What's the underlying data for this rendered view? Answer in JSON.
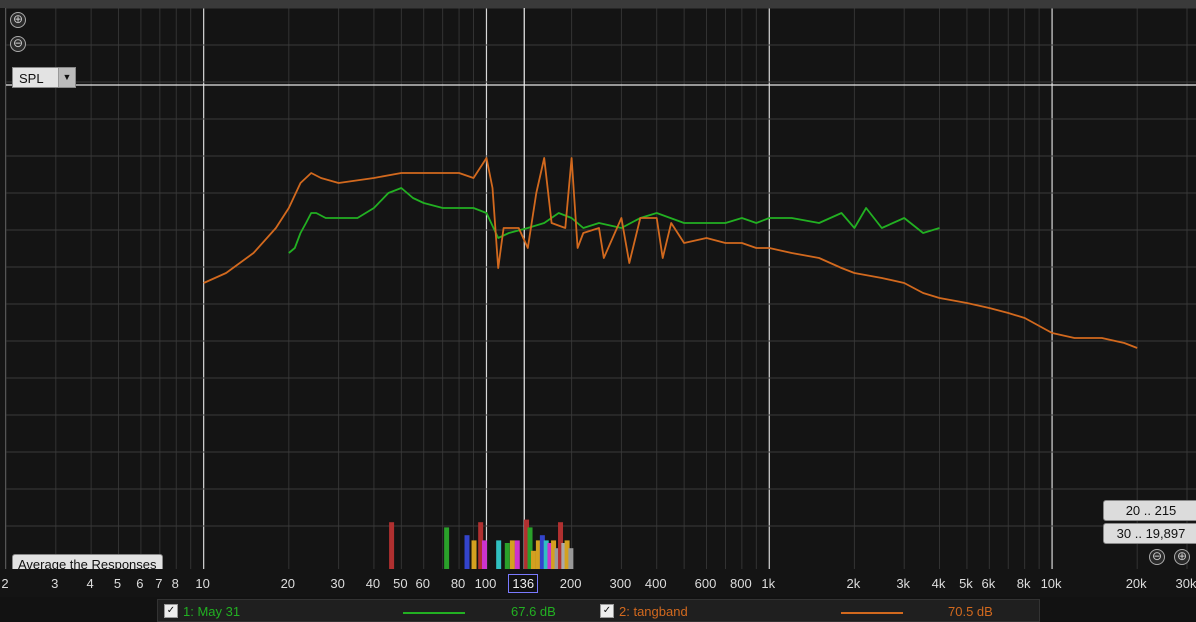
{
  "topbar": {},
  "controls": {
    "zoom_in": "⊕",
    "zoom_out": "⊖",
    "display_mode": "SPL",
    "average_button": "Average the Responses",
    "range_low": "20 .. 215",
    "range_high": "30 .. 19,897",
    "bottom_zoom_out": "⊖",
    "bottom_zoom_in": "⊕"
  },
  "axis": {
    "ticks": [
      "2",
      "3",
      "4",
      "5",
      "6",
      "7",
      "8",
      "10",
      "20",
      "30",
      "40",
      "50",
      "60",
      "80",
      "100",
      "136",
      "200",
      "300",
      "400",
      "600",
      "800",
      "1k",
      "2k",
      "3k",
      "4k",
      "5k",
      "6k",
      "8k",
      "10k",
      "20k",
      "30k"
    ],
    "tick_freqs": [
      2,
      3,
      4,
      5,
      6,
      7,
      8,
      10,
      20,
      30,
      40,
      50,
      60,
      80,
      100,
      136,
      200,
      300,
      400,
      600,
      800,
      1000,
      2000,
      3000,
      4000,
      5000,
      6000,
      8000,
      10000,
      20000,
      30000
    ],
    "cursor_label": "136",
    "cursor_freq": 136,
    "f_min": 2,
    "f_max": 30000
  },
  "legend": {
    "items": [
      {
        "checked": "✓",
        "label": "1: May 31",
        "value": "67.6 dB",
        "color": "#22b022"
      },
      {
        "checked": "✓",
        "label": "2: tangband",
        "value": "70.5 dB",
        "color": "#d2691e"
      }
    ]
  },
  "chart_data": {
    "type": "line",
    "x_scale": "log",
    "xlim": [
      2,
      30000
    ],
    "ylim": [
      0,
      100
    ],
    "series": [
      {
        "name": "1: May 31",
        "color": "#22b022",
        "points": [
          [
            20,
            51
          ],
          [
            21,
            52
          ],
          [
            22,
            55
          ],
          [
            23,
            57
          ],
          [
            24,
            59
          ],
          [
            25,
            59
          ],
          [
            27,
            58
          ],
          [
            30,
            58
          ],
          [
            35,
            58
          ],
          [
            40,
            60
          ],
          [
            45,
            63
          ],
          [
            50,
            64
          ],
          [
            55,
            62
          ],
          [
            60,
            61
          ],
          [
            70,
            60
          ],
          [
            80,
            60
          ],
          [
            90,
            60
          ],
          [
            100,
            59
          ],
          [
            110,
            54
          ],
          [
            120,
            55
          ],
          [
            140,
            56
          ],
          [
            160,
            57
          ],
          [
            180,
            59
          ],
          [
            200,
            58
          ],
          [
            220,
            56
          ],
          [
            250,
            57
          ],
          [
            300,
            56
          ],
          [
            350,
            58
          ],
          [
            400,
            59
          ],
          [
            500,
            57
          ],
          [
            600,
            57
          ],
          [
            700,
            57
          ],
          [
            800,
            58
          ],
          [
            900,
            57
          ],
          [
            1000,
            58
          ],
          [
            1200,
            58
          ],
          [
            1500,
            57
          ],
          [
            1800,
            59
          ],
          [
            2000,
            56
          ],
          [
            2200,
            60
          ],
          [
            2500,
            56
          ],
          [
            3000,
            58
          ],
          [
            3500,
            55
          ],
          [
            4000,
            56
          ]
        ]
      },
      {
        "name": "2: tangband",
        "color": "#d2691e",
        "points": [
          [
            10,
            45
          ],
          [
            12,
            47
          ],
          [
            15,
            51
          ],
          [
            18,
            56
          ],
          [
            20,
            60
          ],
          [
            22,
            65
          ],
          [
            24,
            67
          ],
          [
            26,
            66
          ],
          [
            30,
            65
          ],
          [
            40,
            66
          ],
          [
            50,
            67
          ],
          [
            60,
            67
          ],
          [
            70,
            67
          ],
          [
            80,
            67
          ],
          [
            90,
            66
          ],
          [
            100,
            70
          ],
          [
            105,
            64
          ],
          [
            110,
            48
          ],
          [
            115,
            56
          ],
          [
            130,
            56
          ],
          [
            140,
            52
          ],
          [
            150,
            63
          ],
          [
            160,
            70
          ],
          [
            170,
            57
          ],
          [
            190,
            56
          ],
          [
            200,
            70
          ],
          [
            210,
            52
          ],
          [
            220,
            55
          ],
          [
            250,
            56
          ],
          [
            260,
            50
          ],
          [
            300,
            58
          ],
          [
            320,
            49
          ],
          [
            350,
            58
          ],
          [
            400,
            58
          ],
          [
            420,
            50
          ],
          [
            450,
            57
          ],
          [
            500,
            53
          ],
          [
            600,
            54
          ],
          [
            700,
            53
          ],
          [
            800,
            53
          ],
          [
            900,
            52
          ],
          [
            1000,
            52
          ],
          [
            1200,
            51
          ],
          [
            1500,
            50
          ],
          [
            1800,
            48
          ],
          [
            2000,
            47
          ],
          [
            2500,
            46
          ],
          [
            3000,
            45
          ],
          [
            3500,
            43
          ],
          [
            4000,
            42
          ],
          [
            5000,
            41
          ],
          [
            6000,
            40
          ],
          [
            7000,
            39
          ],
          [
            8000,
            38
          ],
          [
            10000,
            35
          ],
          [
            12000,
            34
          ],
          [
            15000,
            34
          ],
          [
            18000,
            33
          ],
          [
            20000,
            32
          ]
        ]
      }
    ],
    "event_bars": [
      {
        "f": 46,
        "h": 0.9,
        "c": "#b03030"
      },
      {
        "f": 72,
        "h": 0.8,
        "c": "#2aa02a"
      },
      {
        "f": 85,
        "h": 0.65,
        "c": "#3344cc"
      },
      {
        "f": 90,
        "h": 0.55,
        "c": "#d4a020"
      },
      {
        "f": 95,
        "h": 0.9,
        "c": "#b03030"
      },
      {
        "f": 98,
        "h": 0.55,
        "c": "#cc33cc"
      },
      {
        "f": 110,
        "h": 0.55,
        "c": "#30c0c0"
      },
      {
        "f": 118,
        "h": 0.5,
        "c": "#2aa02a"
      },
      {
        "f": 123,
        "h": 0.55,
        "c": "#d4a020"
      },
      {
        "f": 128,
        "h": 0.55,
        "c": "#cc33cc"
      },
      {
        "f": 138,
        "h": 0.95,
        "c": "#b03030"
      },
      {
        "f": 142,
        "h": 0.8,
        "c": "#2aa02a"
      },
      {
        "f": 146,
        "h": 0.35,
        "c": "#d4a020"
      },
      {
        "f": 152,
        "h": 0.55,
        "c": "#d4a020"
      },
      {
        "f": 157,
        "h": 0.65,
        "c": "#3344cc"
      },
      {
        "f": 162,
        "h": 0.55,
        "c": "#30c0c0"
      },
      {
        "f": 167,
        "h": 0.5,
        "c": "#cc33cc"
      },
      {
        "f": 172,
        "h": 0.55,
        "c": "#d4a020"
      },
      {
        "f": 177,
        "h": 0.4,
        "c": "#999999"
      },
      {
        "f": 182,
        "h": 0.9,
        "c": "#b03030"
      },
      {
        "f": 187,
        "h": 0.5,
        "c": "#aaaaaa"
      },
      {
        "f": 192,
        "h": 0.55,
        "c": "#d4a020"
      },
      {
        "f": 198,
        "h": 0.4,
        "c": "#999999"
      }
    ]
  }
}
